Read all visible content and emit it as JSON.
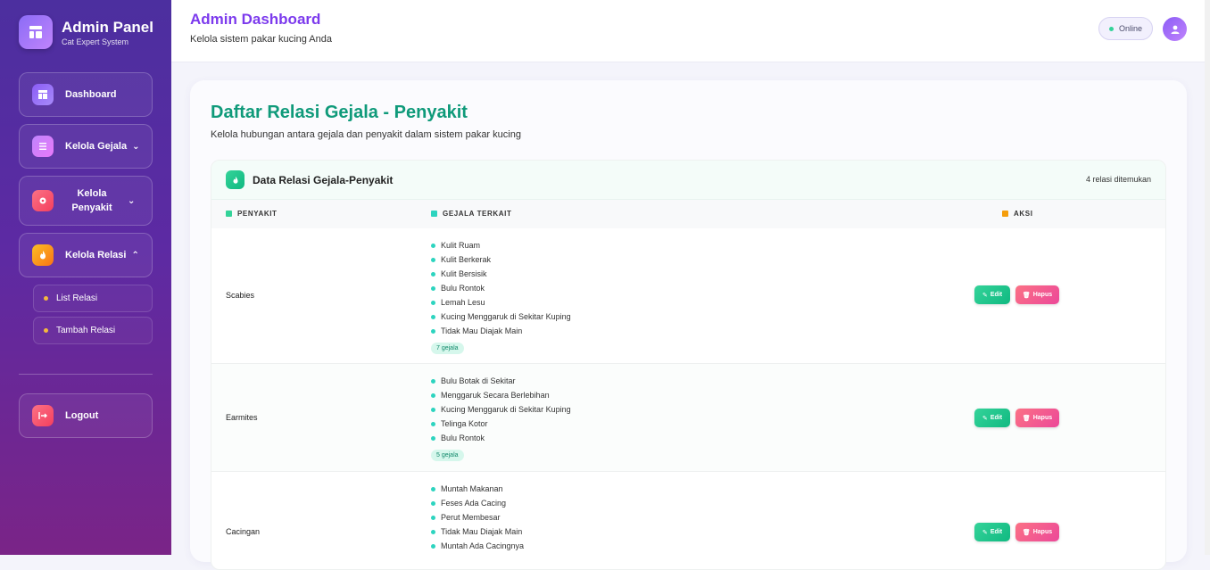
{
  "sidebar": {
    "brand_title": "Admin Panel",
    "brand_subtitle": "Cat Expert System",
    "nav": {
      "dashboard": "Dashboard",
      "kelola_gejala": "Kelola Gejala",
      "kelola_penyakit": "Kelola Penyakit",
      "kelola_relasi": "Kelola Relasi",
      "list_relasi": "List Relasi",
      "tambah_relasi": "Tambah Relasi",
      "logout": "Logout"
    }
  },
  "header": {
    "title": "Admin Dashboard",
    "subtitle": "Kelola sistem pakar kucing Anda",
    "status": "Online"
  },
  "page": {
    "title": "Daftar Relasi Gejala - Penyakit",
    "subtitle": "Kelola hubungan antara gejala dan penyakit dalam sistem pakar kucing"
  },
  "table": {
    "title": "Data Relasi Gejala-Penyakit",
    "count": "4 relasi ditemukan",
    "columns": {
      "disease": "PENYAKIT",
      "symptoms": "GEJALA TERKAIT",
      "actions": "AKSI"
    },
    "edit_label": "Edit",
    "delete_label": "Hapus",
    "rows": [
      {
        "disease": "Scabies",
        "symptoms": [
          "Kulit Ruam",
          "Kulit Berkerak",
          "Kulit Bersisik",
          "Bulu Rontok",
          "Lemah Lesu",
          "Kucing Menggaruk di Sekitar Kuping",
          "Tidak Mau Diajak Main"
        ],
        "count": "7 gejala"
      },
      {
        "disease": "Earmites",
        "symptoms": [
          "Bulu Botak di Sekitar",
          "Menggaruk Secara Berlebihan",
          "Kucing Menggaruk di Sekitar Kuping",
          "Telinga Kotor",
          "Bulu Rontok"
        ],
        "count": "5 gejala"
      },
      {
        "disease": "Cacingan",
        "symptoms": [
          "Muntah Makanan",
          "Feses Ada Cacing",
          "Perut Membesar",
          "Tidak Mau Diajak Main",
          "Muntah Ada Cacingnya"
        ],
        "count": ""
      }
    ]
  },
  "colors": {
    "accent_purple": "#7c3aed",
    "accent_green": "#0f9a7a",
    "sidebar_top": "#4c2f9f",
    "sidebar_bottom": "#7a2487"
  }
}
